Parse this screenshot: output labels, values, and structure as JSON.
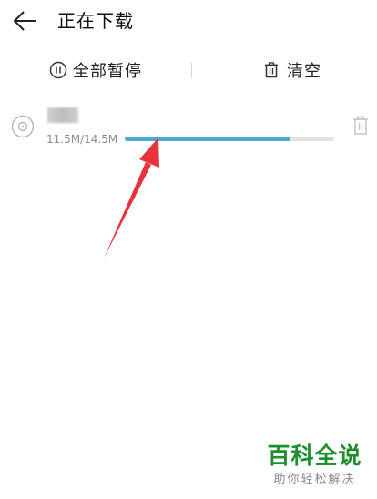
{
  "header": {
    "title": "正在下载",
    "back_icon": "arrow-left-icon"
  },
  "toolbar": {
    "pause_all_label": "全部暂停",
    "pause_icon": "pause-circle-icon",
    "clear_label": "清空",
    "clear_icon": "trash-icon"
  },
  "downloads": [
    {
      "icon": "disc-icon",
      "size_text": "11.5M/14.5M",
      "progress": 0.79,
      "delete_icon": "trash-icon"
    }
  ],
  "colors": {
    "progress_fill": "#4aa8d8",
    "progress_track": "#e2e2e2",
    "annotation_arrow": "#e8323c",
    "watermark_green": "#1f8f2e"
  },
  "watermark": {
    "main": "百科全说",
    "sub": "助你轻松解决"
  }
}
